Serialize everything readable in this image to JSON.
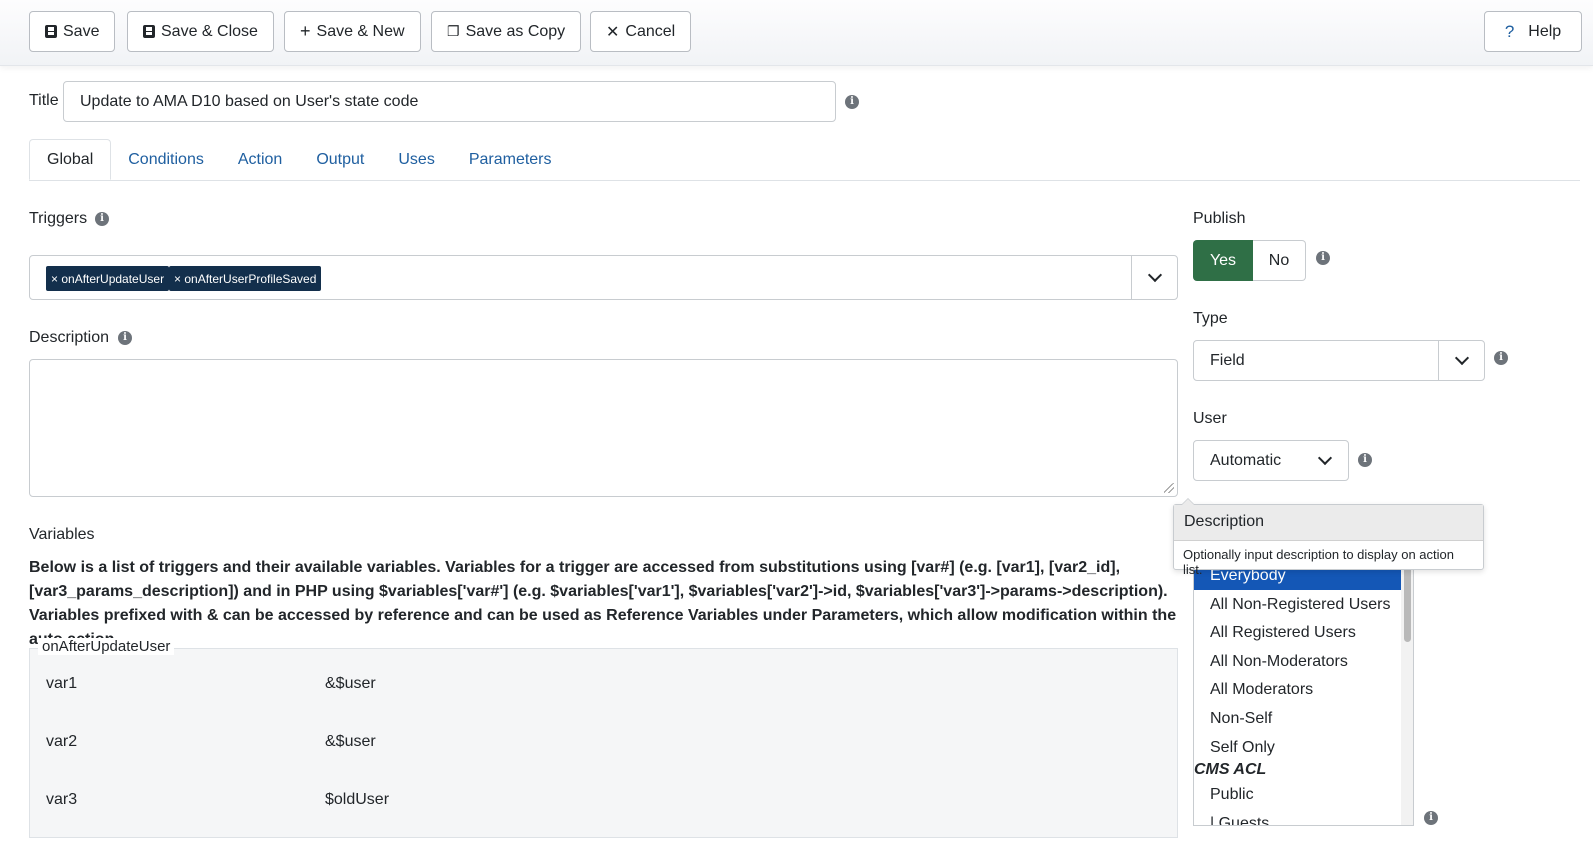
{
  "toolbar": {
    "save": "Save",
    "save_close": "Save & Close",
    "save_new": "Save & New",
    "save_copy": "Save as Copy",
    "cancel": "Cancel",
    "help": "Help"
  },
  "title": {
    "label": "Title",
    "value": "Update to AMA D10 based on User's state code"
  },
  "tabs": [
    {
      "label": "Global",
      "active": true
    },
    {
      "label": "Conditions"
    },
    {
      "label": "Action"
    },
    {
      "label": "Output"
    },
    {
      "label": "Uses"
    },
    {
      "label": "Parameters"
    }
  ],
  "triggers": {
    "label": "Triggers",
    "chips": [
      "× onAfterUpdateUser",
      "× onAfterUserProfileSaved"
    ]
  },
  "description": {
    "label": "Description",
    "value": ""
  },
  "variables": {
    "label": "Variables",
    "text": "Below is a list of triggers and their available variables. Variables for a trigger are accessed from substitutions using [var#] (e.g. [var1], [var2_id], [var3_params_description]) and in PHP using $variables['var#'] (e.g. $variables['var1'], $variables['var2']->id, $variables['var3']->params->description). Variables prefixed with & can be accessed by reference and can be used as Reference Variables under Parameters, which allow modification within the auto action.",
    "group": "onAfterUpdateUser",
    "rows": [
      {
        "name": "var1",
        "value": "&$user"
      },
      {
        "name": "var2",
        "value": "&$user"
      },
      {
        "name": "var3",
        "value": "$oldUser"
      }
    ]
  },
  "publish": {
    "label": "Publish",
    "yes": "Yes",
    "no": "No"
  },
  "type": {
    "label": "Type",
    "value": "Field"
  },
  "user": {
    "label": "User",
    "value": "Automatic"
  },
  "tooltip": {
    "title": "Description",
    "body": "Optionally input description to display on action list."
  },
  "access": {
    "options": [
      "Everybody",
      "All Non-Registered Users",
      "All Registered Users",
      "All Non-Moderators",
      "All Moderators",
      "Non-Self",
      "Self Only"
    ],
    "group_label": "CMS ACL",
    "acl_options": [
      "Public",
      "| Guests"
    ]
  },
  "colors": {
    "yes_green": "#2f6f46",
    "chip_navy": "#132f4c",
    "link_blue": "#1f5fa0",
    "selected_blue": "#1457b6"
  }
}
